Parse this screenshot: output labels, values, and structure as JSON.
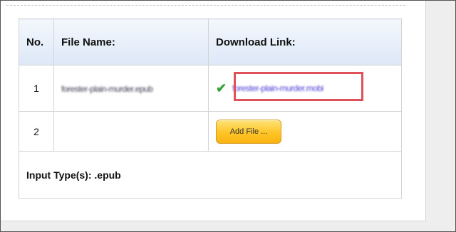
{
  "table": {
    "headers": {
      "no": "No.",
      "file_name": "File Name:",
      "download_link": "Download Link:"
    },
    "rows": [
      {
        "no": "1",
        "file_name": "forester-plain-murder.epub",
        "download_link": "forester-plain-murder.mobi",
        "status_icon": "check-icon"
      },
      {
        "no": "2",
        "file_name": "",
        "add_button_label": "Add File ..."
      }
    ],
    "input_types": "Input Type(s): .epub"
  },
  "colors": {
    "highlight": "#e0525b",
    "check": "#3aa23a",
    "link": "#4a3bd6",
    "button": "#ffc426"
  }
}
